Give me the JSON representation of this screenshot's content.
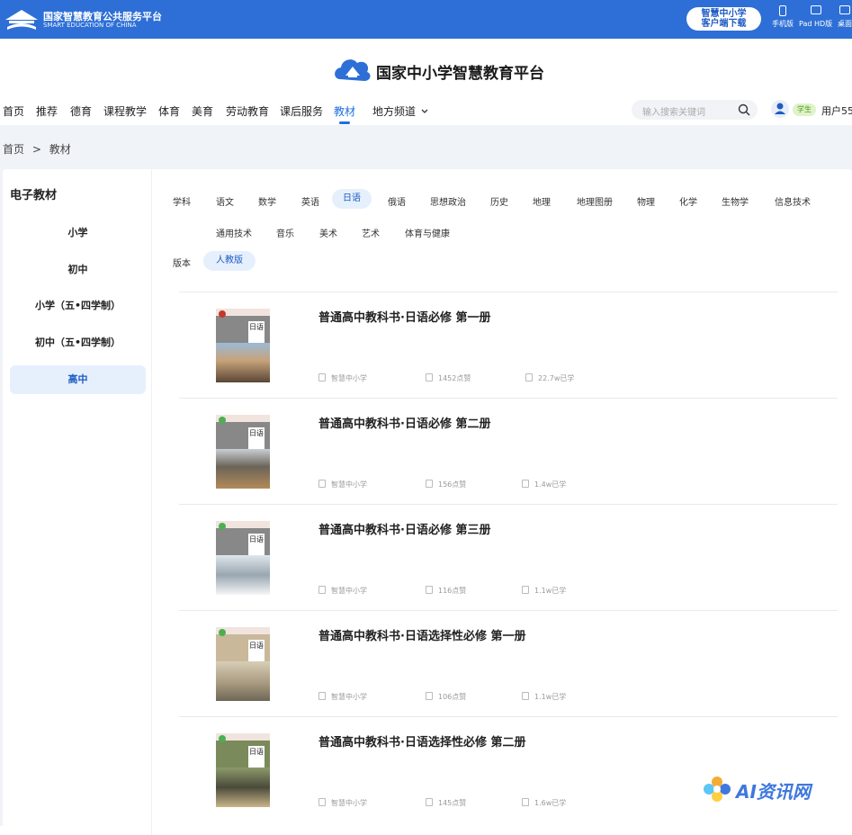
{
  "topbar": {
    "logo_cn": "国家智慧教育公共服务平台",
    "logo_en": "SMART EDUCATION OF CHINA",
    "download_line1": "智慧中小学",
    "download_line2": "客户端下载",
    "devices": [
      "手机版",
      "Pad HD版",
      "桌面"
    ]
  },
  "brand": {
    "title": "国家中小学智慧教育平台"
  },
  "nav": {
    "items": [
      "首页",
      "推荐",
      "德育",
      "课程教学",
      "体育",
      "美育",
      "劳动教育",
      "课后服务",
      "教材",
      "地方频道"
    ],
    "active": "教材",
    "search_placeholder": "输入搜索关键词",
    "user_badge": "学生",
    "user_name": "用户55"
  },
  "breadcrumb": {
    "home": "首页",
    "sep": ">",
    "current": "教材"
  },
  "sidebar": {
    "title": "电子教材",
    "items": [
      "小学",
      "初中",
      "小学（五•四学制）",
      "初中（五•四学制）",
      "高中"
    ],
    "active": "高中"
  },
  "subjects": {
    "row1": [
      "学科",
      "语文",
      "数学",
      "英语",
      "日语",
      "俄语",
      "思想政治",
      "历史",
      "地理",
      "地理图册",
      "物理",
      "化学",
      "生物学",
      "信息技术"
    ],
    "row2": [
      "通用技术",
      "音乐",
      "美术",
      "艺术",
      "体育与健康"
    ],
    "active": "日语"
  },
  "version": {
    "label": "版本",
    "active": "人教版"
  },
  "books": [
    {
      "title": "普通高中教科书·日语必修 第一册",
      "source": "智慧中小学",
      "likes": "1452点赞",
      "learners": "22.7w已学",
      "cover_title": "日语"
    },
    {
      "title": "普通高中教科书·日语必修 第二册",
      "source": "智慧中小学",
      "likes": "156点赞",
      "learners": "1.4w已学",
      "cover_title": "日语"
    },
    {
      "title": "普通高中教科书·日语必修 第三册",
      "source": "智慧中小学",
      "likes": "116点赞",
      "learners": "1.1w已学",
      "cover_title": "日语"
    },
    {
      "title": "普通高中教科书·日语选择性必修 第一册",
      "source": "智慧中小学",
      "likes": "106点赞",
      "learners": "1.1w已学",
      "cover_title": "日语"
    },
    {
      "title": "普通高中教科书·日语选择性必修 第二册",
      "source": "智慧中小学",
      "likes": "145点赞",
      "learners": "1.6w已学",
      "cover_title": "日语"
    }
  ],
  "watermark": {
    "text": "AI资讯网"
  },
  "colors": {
    "primary": "#2d6fd6",
    "active": "#1f6fe0",
    "chip_bg": "#e6f0fd"
  }
}
